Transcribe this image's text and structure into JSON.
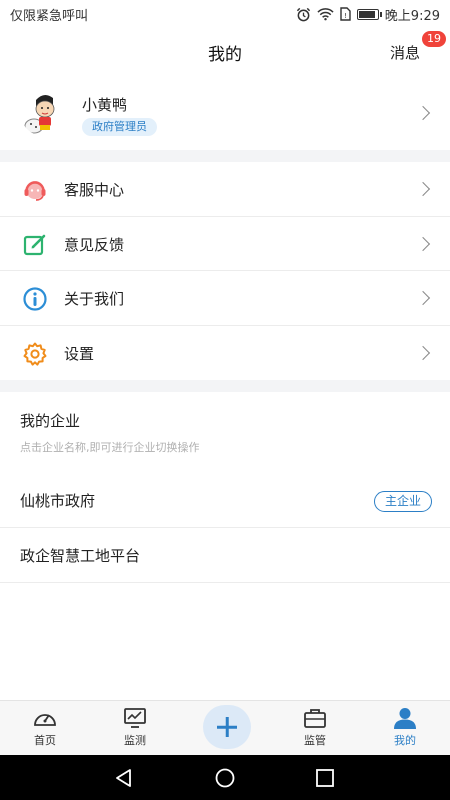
{
  "status_bar": {
    "carrier": "仅限紧急呼叫",
    "time": "晚上9:29",
    "battery_level": 0.8,
    "icons": [
      "alarm-icon",
      "wifi-icon",
      "sim-card-icon",
      "battery-icon"
    ]
  },
  "header": {
    "title": "我的",
    "messages_label": "消息",
    "messages_count": "19"
  },
  "profile": {
    "avatar_icon": "cartoon-avatar",
    "name": "小黄鸭",
    "role": "政府管理员"
  },
  "menu": [
    {
      "label": "客服中心",
      "icon": "customer-service-icon",
      "color": "#ef5b5b"
    },
    {
      "label": "意见反馈",
      "icon": "feedback-edit-icon",
      "color": "#2db36f"
    },
    {
      "label": "关于我们",
      "icon": "info-icon",
      "color": "#2c8ed6"
    },
    {
      "label": "设置",
      "icon": "settings-gear-icon",
      "color": "#f08c1a"
    }
  ],
  "enterprise": {
    "title": "我的企业",
    "hint": "点击企业名称,即可进行企业切换操作",
    "items": [
      {
        "name": "仙桃市政府",
        "badge": "主企业"
      },
      {
        "name": "政企智慧工地平台",
        "badge": ""
      }
    ]
  },
  "tabbar": {
    "tabs": [
      {
        "label": "首页",
        "icon": "dashboard-icon"
      },
      {
        "label": "监测",
        "icon": "monitor-chart-icon"
      },
      {
        "label": "",
        "icon": "plus-icon"
      },
      {
        "label": "监管",
        "icon": "toolbox-icon"
      },
      {
        "label": "我的",
        "icon": "user-icon"
      }
    ],
    "active_index": 4
  },
  "colors": {
    "accent": "#2c7fc6",
    "badge_red": "#f0433a"
  }
}
